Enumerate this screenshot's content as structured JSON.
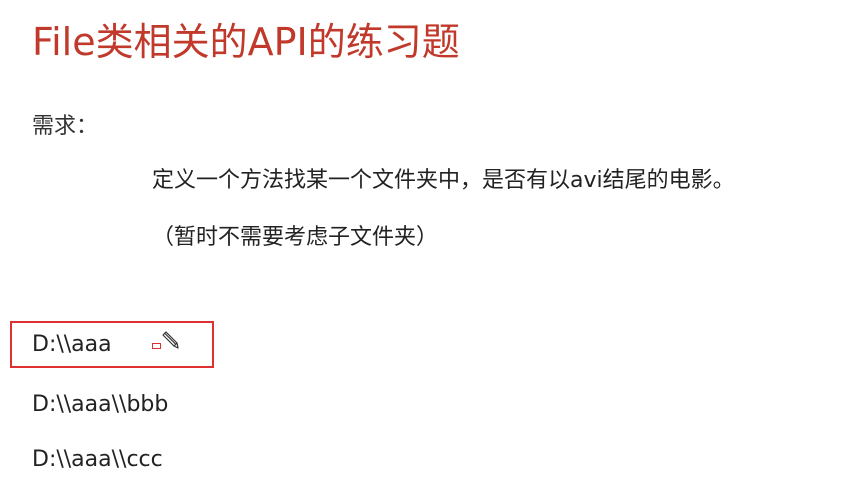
{
  "slide": {
    "title": "File类相关的API的练习题",
    "requirement_label": "需求：",
    "requirement_lines": [
      "定义一个方法找某一个文件夹中，是否有以avi结尾的电影。",
      "（暂时不需要考虑子文件夹）"
    ],
    "paths": [
      "D:\\\\aaa",
      "D:\\\\aaa\\\\bbb",
      "D:\\\\aaa\\\\ccc"
    ]
  },
  "colors": {
    "title": "#c0392b",
    "highlight_border": "#e03131",
    "text": "#222222"
  },
  "icons": {
    "edit_mark": "pencil-icon"
  }
}
